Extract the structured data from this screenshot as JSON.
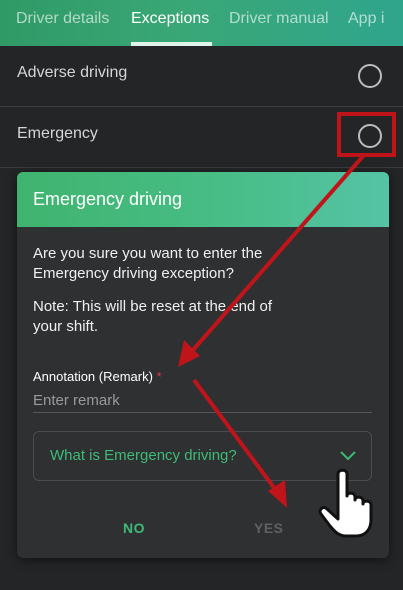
{
  "tabs": [
    {
      "label": "Driver details"
    },
    {
      "label": "Exceptions"
    },
    {
      "label": "Driver manual"
    },
    {
      "label": "App i"
    }
  ],
  "exceptions": [
    {
      "label": "Adverse driving"
    },
    {
      "label": "Emergency"
    }
  ],
  "dialog": {
    "title": "Emergency driving",
    "line1": "Are you sure you want to enter the",
    "line2": "Emergency driving exception?",
    "note1": "Note: This will be reset at the end of",
    "note2": "your shift.",
    "annotation_label": "Annotation (Remark)",
    "required_mark": "*",
    "remark_placeholder": "Enter remark",
    "expander_label": "What is Emergency driving?",
    "no_label": "NO",
    "yes_label": "YES"
  },
  "colors": {
    "accent_green": "#3dbb76",
    "highlight_red": "#c0141b"
  },
  "icons": [
    "radio-empty-icon",
    "chevron-down-icon",
    "hand-pointer-icon",
    "arrow-icon"
  ]
}
